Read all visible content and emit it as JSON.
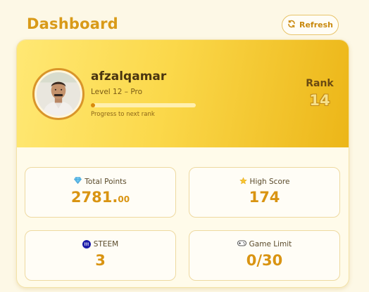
{
  "header": {
    "title": "Dashboard",
    "refresh_label": "Refresh"
  },
  "profile": {
    "username": "afzalqamar",
    "level": "Level 12 – Pro",
    "progress_label": "Progress to next rank",
    "progress_fraction": 0.03,
    "rank_label": "Rank",
    "rank_value": "14"
  },
  "stats": {
    "total_points": {
      "icon": "diamond-icon",
      "label": "Total Points",
      "value_int": "2781.",
      "value_dec": "00"
    },
    "high_score": {
      "icon": "star-icon",
      "label": "High Score",
      "value": "174"
    },
    "steem": {
      "icon": "steem-icon",
      "label": "STEEM",
      "value": "3"
    },
    "game_limit": {
      "icon": "gamepad-icon",
      "label": "Game Limit",
      "value": "0/30"
    }
  },
  "colors": {
    "accent": "#d99a18",
    "hero_start": "#ffe874",
    "hero_end": "#ecb618"
  }
}
